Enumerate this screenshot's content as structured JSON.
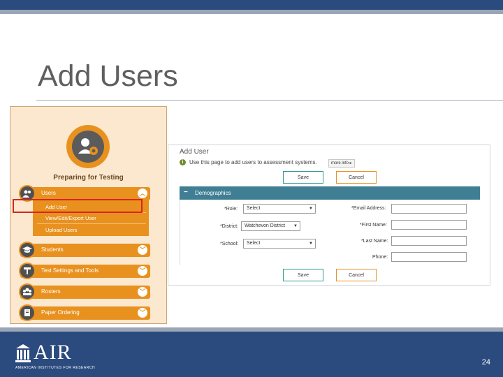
{
  "slide": {
    "title": "Add Users",
    "page_number": "24"
  },
  "left_menu": {
    "heading": "Preparing for Testing",
    "items": [
      {
        "label": "Users",
        "icon": "users-icon",
        "expanded": true
      },
      {
        "label": "Students",
        "icon": "graduation-cap-icon",
        "expanded": false
      },
      {
        "label": "Test Settings and Tools",
        "icon": "settings-tools-icon",
        "expanded": false
      },
      {
        "label": "Rosters",
        "icon": "rosters-icon",
        "expanded": false
      },
      {
        "label": "Paper Ordering",
        "icon": "paper-ordering-icon",
        "expanded": false
      }
    ],
    "users_submenu": [
      "Add User",
      "View/Edit/Export User",
      "Upload Users"
    ],
    "highlighted": "Add User"
  },
  "form": {
    "title": "Add User",
    "info_text": "Use this page to add users to assessment systems.",
    "more_info": "more info ▸",
    "save_label": "Save",
    "cancel_label": "Cancel",
    "section_label": "Demographics",
    "fields_left": [
      {
        "label": "*Role:",
        "value": "Select"
      },
      {
        "label": "*District:",
        "value": "Watchevon District"
      },
      {
        "label": "*School:",
        "value": "Select"
      }
    ],
    "fields_right": [
      {
        "label": "*Email Address:",
        "value": ""
      },
      {
        "label": "*First Name:",
        "value": ""
      },
      {
        "label": "*Last Name:",
        "value": ""
      },
      {
        "label": "Phone:",
        "value": ""
      }
    ]
  },
  "footer": {
    "logo_text": "AIR",
    "logo_subtext": "AMERICAN INSTITUTES FOR RESEARCH"
  },
  "colors": {
    "header_bar": "#2b4a7e",
    "accent_orange": "#e8911e",
    "section_teal": "#3f7e93",
    "highlight_red": "#d8261c"
  }
}
